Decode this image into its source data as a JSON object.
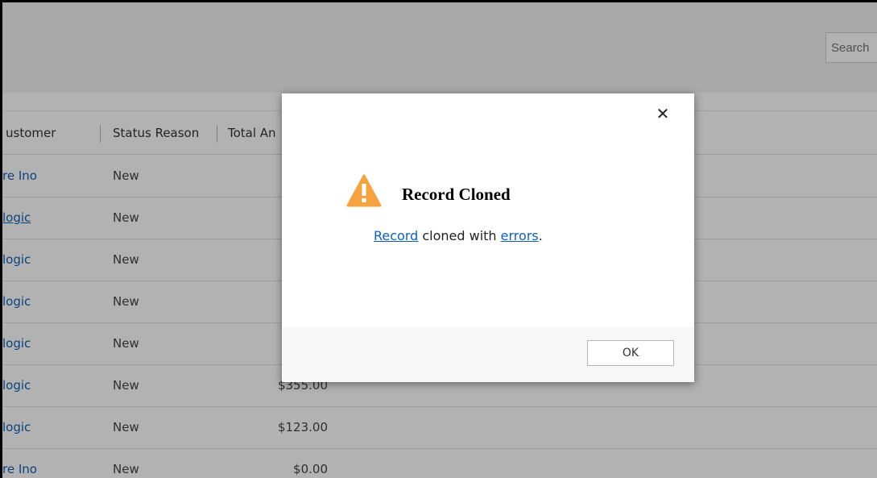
{
  "search": {
    "placeholder": "Search"
  },
  "grid": {
    "columns": [
      {
        "label": "ustomer"
      },
      {
        "label": "Status Reason"
      },
      {
        "label": "Total An"
      }
    ],
    "rows": [
      {
        "customer": "re Ino",
        "status": "New",
        "amount": ""
      },
      {
        "customer": "logic",
        "status": "New",
        "amount": "$"
      },
      {
        "customer": "logic",
        "status": "New",
        "amount": "$"
      },
      {
        "customer": "logic",
        "status": "New",
        "amount": "$"
      },
      {
        "customer": "logic",
        "status": "New",
        "amount": "$"
      },
      {
        "customer": "logic",
        "status": "New",
        "amount": "$355.00"
      },
      {
        "customer": "logic",
        "status": "New",
        "amount": "$123.00"
      },
      {
        "customer": "re Ino",
        "status": "New",
        "amount": "$0.00"
      }
    ]
  },
  "dialog": {
    "close_glyph": "✕",
    "icon": "warning-icon",
    "title": "Record Cloned",
    "message": {
      "link1": "Record",
      "middle": " cloned with ",
      "link2": "errors",
      "end": "."
    },
    "ok_label": "OK"
  },
  "colors": {
    "link": "#1160b7",
    "warning": "#f5a341",
    "overlay": "rgba(0,0,0,0.30)"
  }
}
